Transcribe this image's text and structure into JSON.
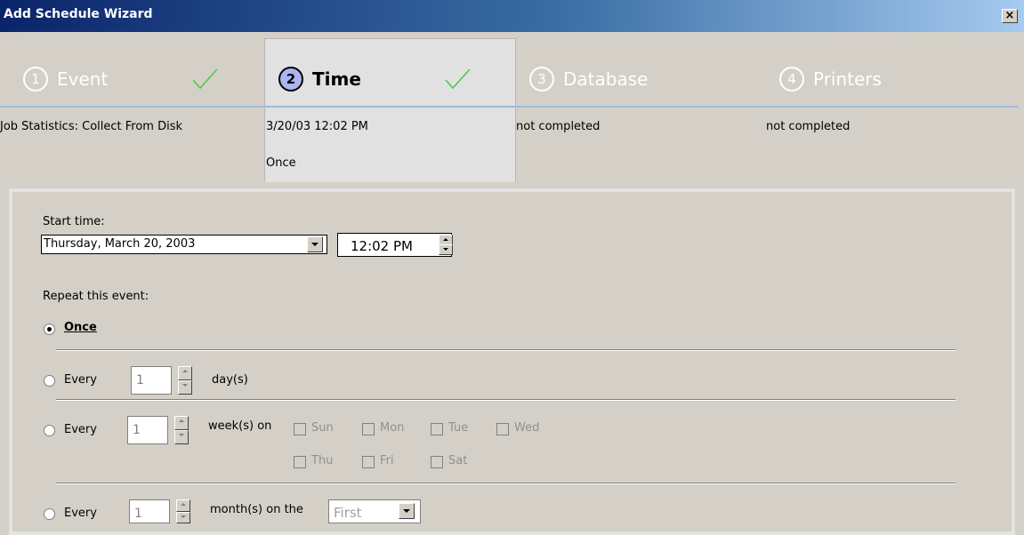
{
  "window": {
    "title": "Add Schedule Wizard",
    "close_label": "×"
  },
  "steps": [
    {
      "number": "1",
      "label": "Event",
      "summary": "Job Statistics: Collect From Disk",
      "completed": true
    },
    {
      "number": "2",
      "label": "Time",
      "summary": "3/20/03 12:02 PM",
      "summary2": "Once",
      "completed": true,
      "active": true
    },
    {
      "number": "3",
      "label": "Database",
      "summary": "not completed",
      "completed": false
    },
    {
      "number": "4",
      "label": "Printers",
      "summary": "not completed",
      "completed": false
    }
  ],
  "form": {
    "start_time_label": "Start time:",
    "date_value": "Thursday, March 20, 2003",
    "time_value": "12:02 PM",
    "repeat_label": "Repeat this event:",
    "options": {
      "once": {
        "label": "Once",
        "selected": true
      },
      "daily": {
        "label": "Every",
        "value": "1",
        "unit": "day(s)"
      },
      "weekly": {
        "label": "Every",
        "value": "1",
        "unit": "week(s) on",
        "days": [
          "Sun",
          "Mon",
          "Tue",
          "Wed",
          "Thu",
          "Fri",
          "Sat"
        ]
      },
      "monthly": {
        "label": "Every",
        "value": "1",
        "unit": "month(s) on the",
        "select_value": "First"
      }
    }
  },
  "colors": {
    "check": "#4fc94f",
    "step_line": "#9ebad8",
    "title_gradient_start": "#0a246a"
  }
}
